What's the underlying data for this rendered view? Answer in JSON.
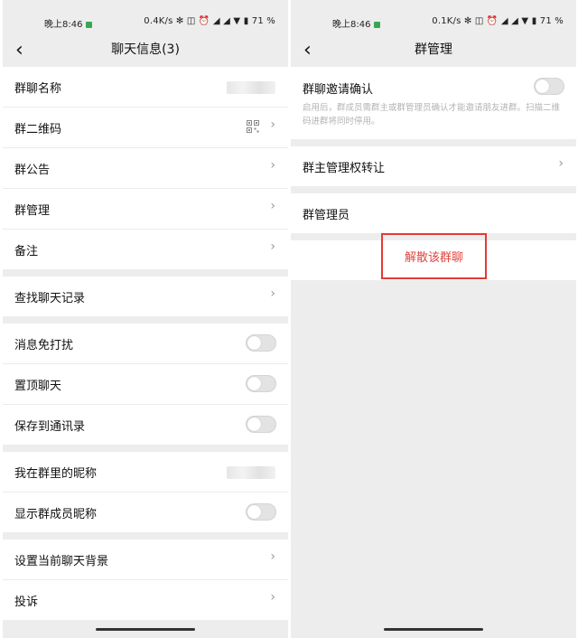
{
  "left": {
    "status": {
      "time": "晚上8:46",
      "right": "0.4K/s ✻ ◫ ⏰ ◢ ◢ ▼ ▮ 71 %"
    },
    "nav": {
      "back": "‹",
      "title": "聊天信息(3)"
    },
    "groups": [
      [
        {
          "label": "群聊名称",
          "accessory": "blur"
        },
        {
          "label": "群二维码",
          "accessory": "qr-chevron"
        },
        {
          "label": "群公告",
          "accessory": "chevron"
        },
        {
          "label": "群管理",
          "accessory": "chevron"
        },
        {
          "label": "备注",
          "accessory": "chevron"
        }
      ],
      [
        {
          "label": "查找聊天记录",
          "accessory": "chevron"
        }
      ],
      [
        {
          "label": "消息免打扰",
          "accessory": "toggle"
        },
        {
          "label": "置顶聊天",
          "accessory": "toggle"
        },
        {
          "label": "保存到通讯录",
          "accessory": "toggle"
        }
      ],
      [
        {
          "label": "我在群里的昵称",
          "accessory": "blur"
        },
        {
          "label": "显示群成员昵称",
          "accessory": "toggle"
        }
      ],
      [
        {
          "label": "设置当前聊天背景",
          "accessory": "chevron"
        },
        {
          "label": "投诉",
          "accessory": "chevron"
        }
      ]
    ],
    "chevron": "›"
  },
  "right": {
    "status": {
      "time": "晚上8:46",
      "right": "0.1K/s ✻ ◫ ⏰ ◢ ◢ ▼ ▮ 71 %"
    },
    "nav": {
      "back": "‹",
      "title": "群管理"
    },
    "invite": {
      "label": "群聊邀请确认",
      "desc": "启用后，群成员需群主或群管理员确认才能邀请朋友进群。扫描二维码进群将同时停用。"
    },
    "transfer_label": "群主管理权转让",
    "admins_label": "群管理员",
    "dissolve_label": "解散该群聊",
    "chevron": "›"
  },
  "colors": {
    "danger": "#e0453f",
    "highlight_border": "#e53935",
    "background": "#ededed"
  }
}
